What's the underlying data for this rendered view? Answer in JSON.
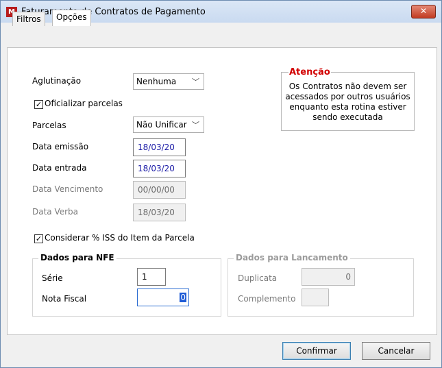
{
  "window": {
    "title": "Faturamento de Contratos de Pagamento",
    "close_glyph": "✕",
    "app_icon_glyph": "M"
  },
  "tabs": [
    {
      "label": "Filtros"
    },
    {
      "label": "Opções"
    }
  ],
  "form": {
    "aglutinacao_label": "Aglutinação",
    "aglutinacao_value": "Nenhuma",
    "oficializar_label": "Oficializar parcelas",
    "parcelas_label": "Parcelas",
    "parcelas_value": "Não Unificar",
    "data_emissao_label": "Data emissão",
    "data_emissao_value": "18/03/20",
    "data_entrada_label": "Data entrada",
    "data_entrada_value": "18/03/20",
    "data_vencimento_label": "Data Vencimento",
    "data_vencimento_value": "00/00/00",
    "data_verba_label": "Data Verba",
    "data_verba_value": "18/03/20",
    "considerar_label": "Considerar % ISS do Item da Parcela",
    "check_glyph": "✓",
    "chevron_glyph": "﹀"
  },
  "warning": {
    "title": "Atenção",
    "text": "Os Contratos não devem ser acessados por outros usuários enquanto esta rotina estiver sendo executada"
  },
  "nfe": {
    "legend": "Dados para NFE",
    "serie_label": "Série",
    "serie_value": "1",
    "nota_label": "Nota Fiscal",
    "nota_value": "0"
  },
  "lancamento": {
    "legend": "Dados para Lancamento",
    "duplicata_label": "Duplicata",
    "duplicata_value": "0",
    "complemento_label": "Complemento",
    "complemento_value": ""
  },
  "buttons": {
    "confirmar_label": "Confirmar",
    "cancelar_label": "Cancelar"
  }
}
